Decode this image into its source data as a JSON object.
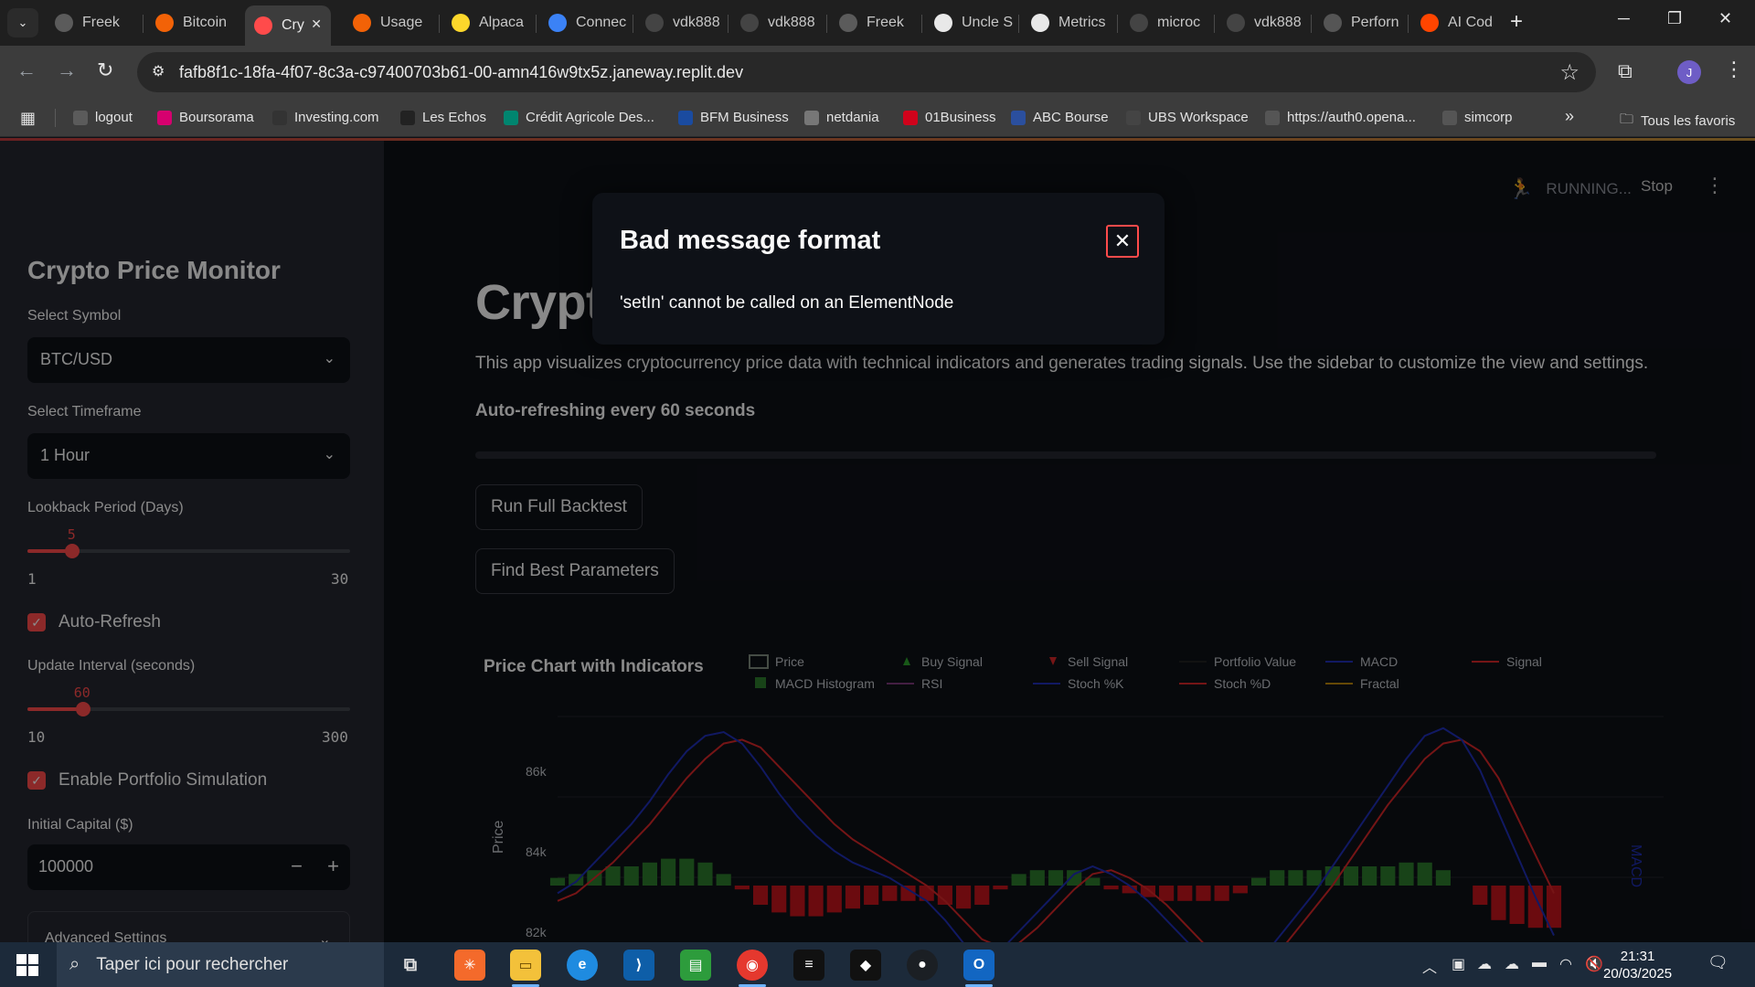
{
  "browser": {
    "tabs": [
      {
        "label": "Freek",
        "icon": "bird-icon",
        "color": "#5b5b5b"
      },
      {
        "label": "Bitcoin",
        "icon": "replit-icon",
        "color": "#f26207"
      },
      {
        "label": "Cry",
        "icon": "chart-icon",
        "color": "#ff4b4b",
        "active": true
      },
      {
        "label": "Usage",
        "icon": "replit-icon",
        "color": "#f26207"
      },
      {
        "label": "Alpaca",
        "icon": "alpaca-icon",
        "color": "#fcd72b"
      },
      {
        "label": "Connec",
        "icon": "globe-icon",
        "color": "#3b82f6"
      },
      {
        "label": "vdk888",
        "icon": "github-icon",
        "color": "#444"
      },
      {
        "label": "vdk888",
        "icon": "github-icon",
        "color": "#444"
      },
      {
        "label": "Freek",
        "icon": "bird-icon",
        "color": "#5b5b5b"
      },
      {
        "label": "Uncle S",
        "icon": "page-icon",
        "color": "#e8e8e8"
      },
      {
        "label": "Metrics",
        "icon": "metrics-icon",
        "color": "#e8e8e8"
      },
      {
        "label": "microc",
        "icon": "crown-icon",
        "color": "#444"
      },
      {
        "label": "vdk888",
        "icon": "github-icon",
        "color": "#444"
      },
      {
        "label": "Perforn",
        "icon": "openai-icon",
        "color": "#555"
      },
      {
        "label": "AI Cod",
        "icon": "reddit-icon",
        "color": "#ff4500"
      }
    ],
    "url": "fafb8f1c-18fa-4f07-8c3a-c97400703b61-00-amn416w9tx5z.janeway.replit.dev",
    "avatar_letter": "J",
    "bookmarks": [
      {
        "label": "logout",
        "color": "#5b5b5b"
      },
      {
        "label": "Boursorama",
        "color": "#d6006f"
      },
      {
        "label": "Investing.com",
        "color": "#333"
      },
      {
        "label": "Les Echos",
        "color": "#222"
      },
      {
        "label": "Crédit Agricole Des...",
        "color": "#00856f"
      },
      {
        "label": "BFM Business",
        "color": "#1a4ba0"
      },
      {
        "label": "netdania",
        "color": "#777"
      },
      {
        "label": "01Business",
        "color": "#d0021b"
      },
      {
        "label": "ABC Bourse",
        "color": "#2b4f9e"
      },
      {
        "label": "UBS Workspace",
        "color": "#444"
      },
      {
        "label": "https://auth0.opena...",
        "color": "#555"
      },
      {
        "label": "simcorp",
        "color": "#555"
      }
    ],
    "all_bookmarks": "Tous les favoris"
  },
  "header": {
    "status": "RUNNING...",
    "stop": "Stop"
  },
  "sidebar": {
    "title": "Crypto Price Monitor",
    "symbol_label": "Select Symbol",
    "symbol_value": "BTC/USD",
    "timeframe_label": "Select Timeframe",
    "timeframe_value": "1 Hour",
    "lookback_label": "Lookback Period (Days)",
    "lookback_value": "5",
    "lookback_min": "1",
    "lookback_max": "30",
    "lookback_fraction": 0.138,
    "autorefresh_label": "Auto-Refresh",
    "interval_label": "Update Interval (seconds)",
    "interval_value": "60",
    "interval_min": "10",
    "interval_max": "300",
    "interval_fraction": 0.172,
    "portfolio_label": "Enable Portfolio Simulation",
    "capital_label": "Initial Capital ($)",
    "capital_value": "100000",
    "advanced_label": "Advanced Settings"
  },
  "main": {
    "title": "Crypto Price Monitor",
    "description": "This app visualizes cryptocurrency price data with technical indicators and generates trading signals. Use the sidebar to customize the view and settings.",
    "refresh_note": "Auto-refreshing every 60 seconds",
    "backtest_button": "Run Full Backtest",
    "params_button": "Find Best Parameters"
  },
  "modal": {
    "title": "Bad message format",
    "body": "'setIn' cannot be called on an ElementNode"
  },
  "chart_data": {
    "type": "line",
    "title": "Price Chart with Indicators",
    "ylabel": "Price",
    "y2label": "MACD",
    "yticks": [
      "86k",
      "84k",
      "82k"
    ],
    "legend": [
      {
        "name": "Price",
        "color": "#7f8a7f",
        "kind": "candle"
      },
      {
        "name": "Buy Signal",
        "color": "#2ca02c",
        "kind": "triangle-up"
      },
      {
        "name": "Sell Signal",
        "color": "#d62728",
        "kind": "triangle-down"
      },
      {
        "name": "Portfolio Value",
        "color": "#222222",
        "kind": "line"
      },
      {
        "name": "MACD",
        "color": "#1f2fb4",
        "kind": "line"
      },
      {
        "name": "Signal",
        "color": "#d62728",
        "kind": "line"
      },
      {
        "name": "MACD Histogram",
        "color": "#2c7a2c",
        "kind": "square"
      },
      {
        "name": "RSI",
        "color": "#7a3a7a",
        "kind": "line"
      },
      {
        "name": "Stoch %K",
        "color": "#1f2fb4",
        "kind": "line"
      },
      {
        "name": "Stoch %D",
        "color": "#d62728",
        "kind": "line"
      },
      {
        "name": "Fractal",
        "color": "#b8860b",
        "kind": "line"
      }
    ],
    "macd": [
      -0.2,
      0.1,
      0.6,
      1.1,
      1.6,
      2.2,
      2.9,
      3.5,
      3.9,
      4.0,
      3.7,
      3.1,
      2.4,
      1.8,
      1.3,
      0.9,
      0.6,
      0.4,
      0.2,
      -0.1,
      -0.4,
      -0.9,
      -1.5,
      -1.9,
      -1.7,
      -1.2,
      -0.7,
      -0.2,
      0.3,
      0.5,
      0.3,
      0.0,
      -0.4,
      -0.9,
      -1.4,
      -1.9,
      -2.3,
      -2.4,
      -2.0,
      -1.4,
      -0.8,
      -0.2,
      0.5,
      1.2,
      1.9,
      2.6,
      3.3,
      3.9,
      4.1,
      3.8,
      3.0,
      1.9,
      0.8,
      -0.3,
      -1.3
    ],
    "signal": [
      -0.4,
      -0.2,
      0.2,
      0.6,
      1.1,
      1.6,
      2.2,
      2.8,
      3.3,
      3.7,
      3.8,
      3.6,
      3.1,
      2.6,
      2.1,
      1.6,
      1.2,
      0.9,
      0.6,
      0.3,
      0.0,
      -0.4,
      -0.9,
      -1.4,
      -1.6,
      -1.5,
      -1.1,
      -0.6,
      -0.1,
      0.3,
      0.4,
      0.2,
      -0.1,
      -0.5,
      -1.0,
      -1.5,
      -1.9,
      -2.2,
      -2.2,
      -1.8,
      -1.2,
      -0.6,
      0.0,
      0.7,
      1.4,
      2.1,
      2.7,
      3.3,
      3.7,
      3.8,
      3.5,
      2.8,
      1.8,
      0.8,
      -0.2
    ],
    "histogram": [
      0.2,
      0.3,
      0.4,
      0.5,
      0.5,
      0.6,
      0.7,
      0.7,
      0.6,
      0.3,
      -0.1,
      -0.5,
      -0.7,
      -0.8,
      -0.8,
      -0.7,
      -0.6,
      -0.5,
      -0.4,
      -0.4,
      -0.4,
      -0.5,
      -0.6,
      -0.5,
      -0.1,
      0.3,
      0.4,
      0.4,
      0.4,
      0.2,
      -0.1,
      -0.2,
      -0.3,
      -0.4,
      -0.4,
      -0.4,
      -0.4,
      -0.2,
      0.2,
      0.4,
      0.4,
      0.4,
      0.5,
      0.5,
      0.5,
      0.5,
      0.6,
      0.6,
      0.4,
      0.0,
      -0.5,
      -0.9,
      -1.0,
      -1.1,
      -1.1
    ]
  },
  "taskbar": {
    "search_placeholder": "Taper ici pour rechercher",
    "time": "21:31",
    "date": "20/03/2025"
  }
}
